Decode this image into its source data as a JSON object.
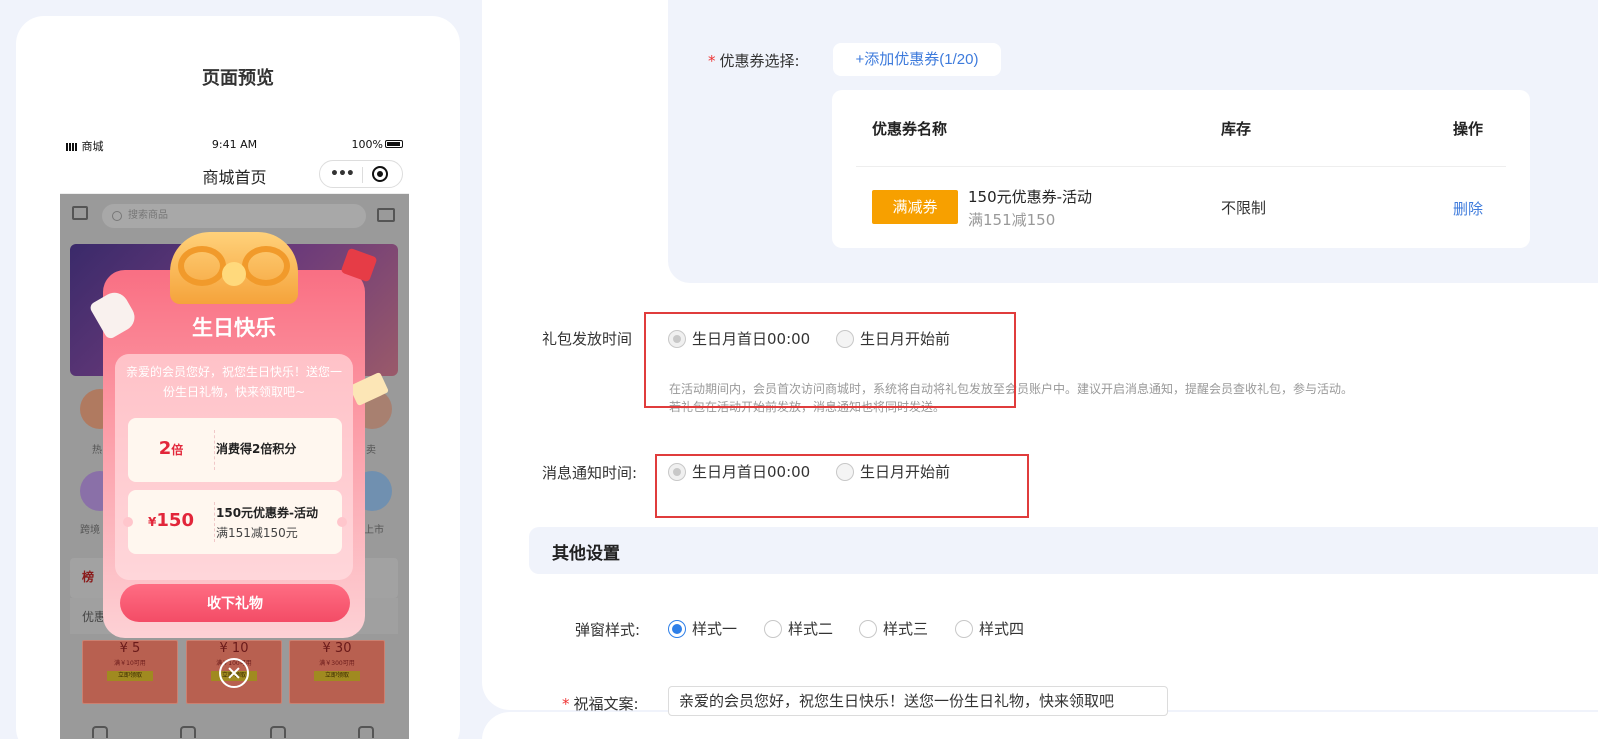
{
  "preview": {
    "title": "页面预览",
    "status_bar": {
      "carrier": "商城",
      "time": "9:41 AM",
      "battery": "100%"
    },
    "nav_title": "商城首页",
    "capsule_more": "•••",
    "search_placeholder": "搜索商品",
    "grid_labels": [
      "热",
      "卖",
      "跨境",
      "上市"
    ],
    "list_head_1": "榜",
    "list_head_2": "优惠",
    "mini_coupons": [
      {
        "amount": "¥ 5",
        "sub": "满￥10可用",
        "btn": "立即领取"
      },
      {
        "amount": "¥ 10",
        "sub": "满￥100可用",
        "btn": "立即领取"
      },
      {
        "amount": "¥ 30",
        "sub": "满￥300可用",
        "btn": "立即领取"
      }
    ],
    "popup": {
      "title": "生日快乐",
      "message": "亲爱的会员您好，祝您生日快乐！送您一份生日礼物，快来领取吧~",
      "benefits": [
        {
          "value": "2",
          "unit": "倍",
          "title": "消费得2倍积分",
          "sub": ""
        },
        {
          "value": "150",
          "unit": "¥",
          "title": "150元优惠券-活动",
          "sub": "满151减150元"
        }
      ],
      "collect_button": "收下礼物"
    }
  },
  "settings": {
    "top_cut_text": "…",
    "coupon_select": {
      "label": "优惠券选择:",
      "add_button": "+添加优惠券(1/20)",
      "table": {
        "headers": [
          "优惠券名称",
          "库存",
          "操作"
        ],
        "rows": [
          {
            "tag": "满减券",
            "name": "150元优惠券-活动",
            "sub": "满151减150",
            "stock": "不限制",
            "action": "删除"
          }
        ]
      }
    },
    "gift_time": {
      "label": "礼包发放时间",
      "options": [
        "生日月首日00:00",
        "生日月开始前"
      ],
      "hint_1": "在活动期间内，会员首次访问商城时，系统将自动将礼包发放至会员账户中。建议开启消息通知，提醒会员查收礼包，参与活动。",
      "hint_2": "若礼包在活动开始前发放，消息通知也将同时发送。"
    },
    "notify_time": {
      "label": "消息通知时间:",
      "options": [
        "生日月首日00:00",
        "生日月开始前"
      ]
    },
    "other_settings": {
      "title": "其他设置",
      "popup_style": {
        "label": "弹窗样式:",
        "options": [
          "样式一",
          "样式二",
          "样式三",
          "样式四"
        ],
        "selected": "样式一"
      },
      "blessing": {
        "label": "祝福文案:",
        "value": "亲爱的会员您好，祝您生日快乐！送您一份生日礼物，快来领取吧"
      }
    }
  },
  "colors": {
    "accent": "#3e7bdc",
    "tag": "#f7a000",
    "highlight": "#e03c3c",
    "popup": "#f96f83"
  }
}
